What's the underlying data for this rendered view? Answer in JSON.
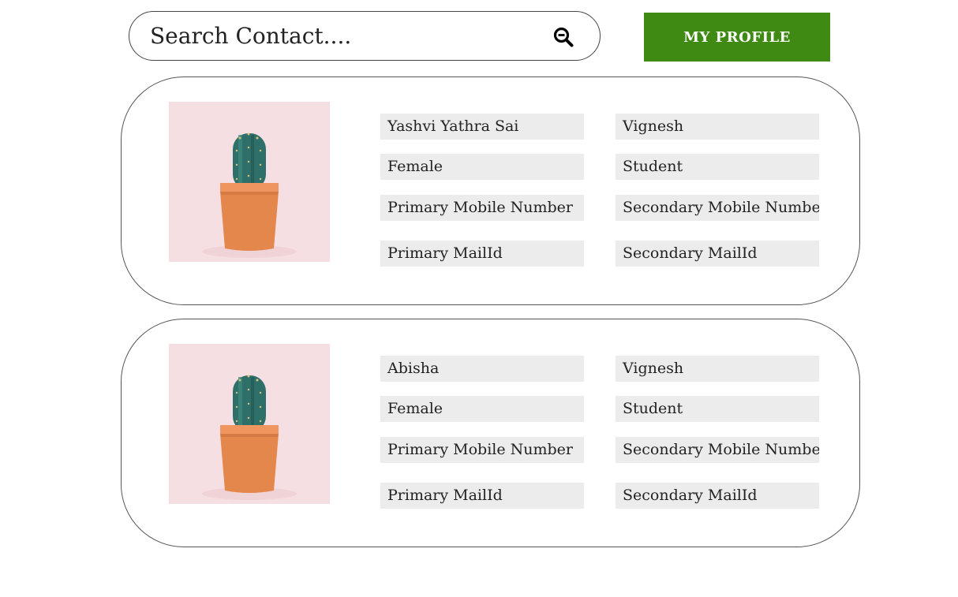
{
  "search": {
    "placeholder": "Search Contact...."
  },
  "header": {
    "profile_button_label": "MY PROFILE",
    "profile_button_color": "#3f8a12"
  },
  "contacts": [
    {
      "name": "Yashvi Yathra Sai",
      "relation": "Vignesh",
      "gender": "Female",
      "occupation": "Student",
      "primary_mobile": "Primary Mobile Number",
      "secondary_mobile": "Secondary Mobile Number",
      "primary_mail": "Primary MailId",
      "secondary_mail": "Secondary MailId",
      "photo": "cactus-in-pot"
    },
    {
      "name": "Abisha",
      "relation": "Vignesh",
      "gender": "Female",
      "occupation": "Student",
      "primary_mobile": "Primary Mobile Number",
      "secondary_mobile": "Secondary Mobile Number",
      "primary_mail": "Primary MailId",
      "secondary_mail": "Secondary MailId",
      "photo": "cactus-in-pot"
    }
  ],
  "icons": {
    "search": "zoom-out-magnifier-icon"
  }
}
